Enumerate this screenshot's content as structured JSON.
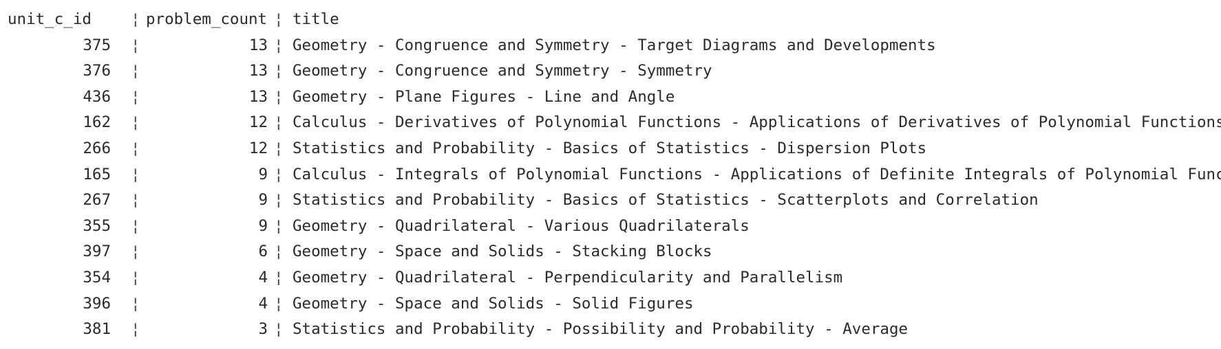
{
  "table": {
    "columns": [
      "unit_c_id",
      "problem_count",
      "title"
    ],
    "separator": "¦",
    "rows": [
      {
        "unit_c_id": "375",
        "problem_count": "13",
        "title": "Geometry - Congruence and Symmetry - Target Diagrams and Developments"
      },
      {
        "unit_c_id": "376",
        "problem_count": "13",
        "title": "Geometry - Congruence and Symmetry - Symmetry"
      },
      {
        "unit_c_id": "436",
        "problem_count": "13",
        "title": "Geometry - Plane Figures - Line and Angle"
      },
      {
        "unit_c_id": "162",
        "problem_count": "12",
        "title": "Calculus - Derivatives of Polynomial Functions - Applications of Derivatives of Polynomial Functions"
      },
      {
        "unit_c_id": "266",
        "problem_count": "12",
        "title": "Statistics and Probability - Basics of Statistics - Dispersion Plots"
      },
      {
        "unit_c_id": "165",
        "problem_count": "9",
        "title": "Calculus - Integrals of Polynomial Functions - Applications of Definite Integrals of Polynomial Functions"
      },
      {
        "unit_c_id": "267",
        "problem_count": "9",
        "title": "Statistics and Probability - Basics of Statistics - Scatterplots and Correlation"
      },
      {
        "unit_c_id": "355",
        "problem_count": "9",
        "title": "Geometry - Quadrilateral - Various Quadrilaterals"
      },
      {
        "unit_c_id": "397",
        "problem_count": "6",
        "title": "Geometry - Space and Solids - Stacking Blocks"
      },
      {
        "unit_c_id": "354",
        "problem_count": "4",
        "title": "Geometry - Quadrilateral - Perpendicularity and Parallelism"
      },
      {
        "unit_c_id": "396",
        "problem_count": "4",
        "title": "Geometry - Space and Solids - Solid Figures"
      },
      {
        "unit_c_id": "381",
        "problem_count": "3",
        "title": "Statistics and Probability - Possibility and Probability - Average"
      }
    ]
  }
}
